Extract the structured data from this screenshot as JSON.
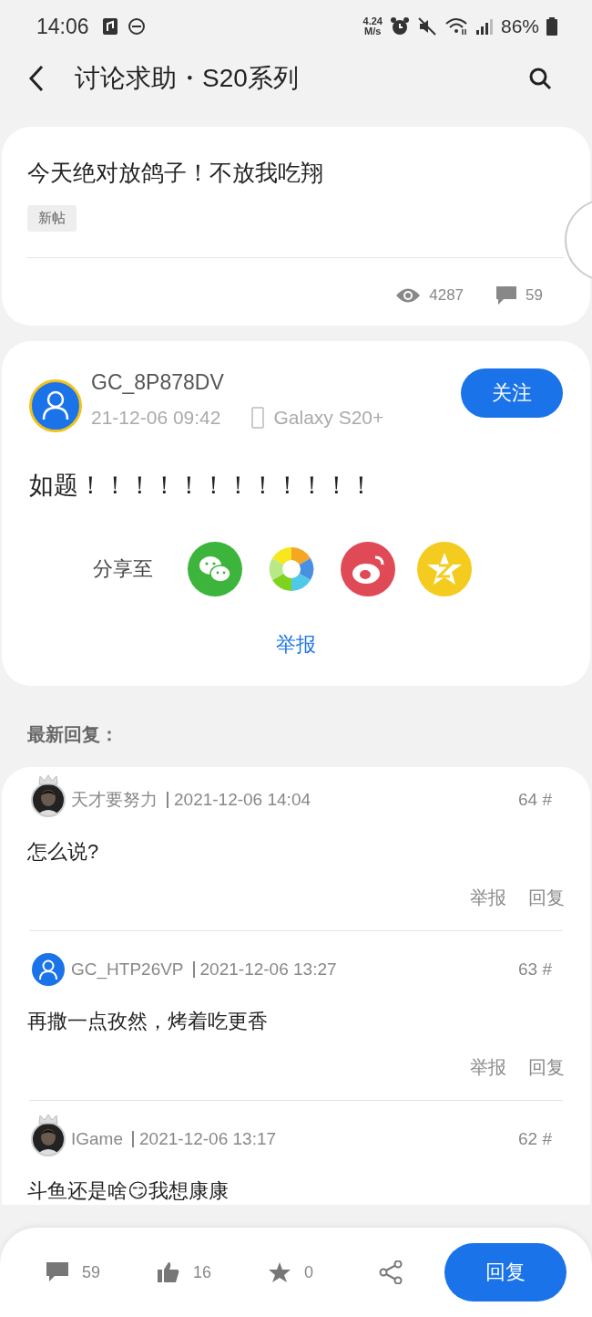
{
  "status_bar": {
    "time": "14:06",
    "speed_value": "4.24",
    "speed_unit": "M/s",
    "battery": "86%"
  },
  "header": {
    "title": "讨论求助・S20系列"
  },
  "topic": {
    "title": "今天绝对放鸽子！不放我吃翔",
    "tags": [
      "新帖"
    ],
    "views": "4287",
    "comments": "59"
  },
  "post": {
    "author": "GC_8P878DV",
    "time": "21-12-06 09:42",
    "device": "Galaxy S20+",
    "follow_label": "关注",
    "body": "如题！！！！！！！！！！！！",
    "share_label": "分享至",
    "share_targets": [
      {
        "kind": "wechat"
      },
      {
        "kind": "moments"
      },
      {
        "kind": "weibo"
      },
      {
        "kind": "qzone"
      }
    ],
    "report_label": "举报"
  },
  "replies_title": "最新回复：",
  "replies": [
    {
      "kind": "picture",
      "crowned": true,
      "author": "天才要努力",
      "time": "2021-12-06 14:04",
      "floor": "64 #",
      "body": "怎么说?",
      "report_label": "举报",
      "reply_label": "回复"
    },
    {
      "kind": "default",
      "crowned": false,
      "author": "GC_HTP26VP",
      "time": "2021-12-06 13:27",
      "floor": "63 #",
      "body": "再撒一点孜然，烤着吃更香",
      "report_label": "举报",
      "reply_label": "回复"
    },
    {
      "kind": "picture",
      "crowned": true,
      "author": "IGame",
      "time": "2021-12-06 13:17",
      "floor": "62 #",
      "body": "斗鱼还是啥😏我想康康"
    }
  ],
  "bottom_bar": {
    "comments": "59",
    "likes": "16",
    "favorites": "0",
    "reply_label": "回复"
  }
}
